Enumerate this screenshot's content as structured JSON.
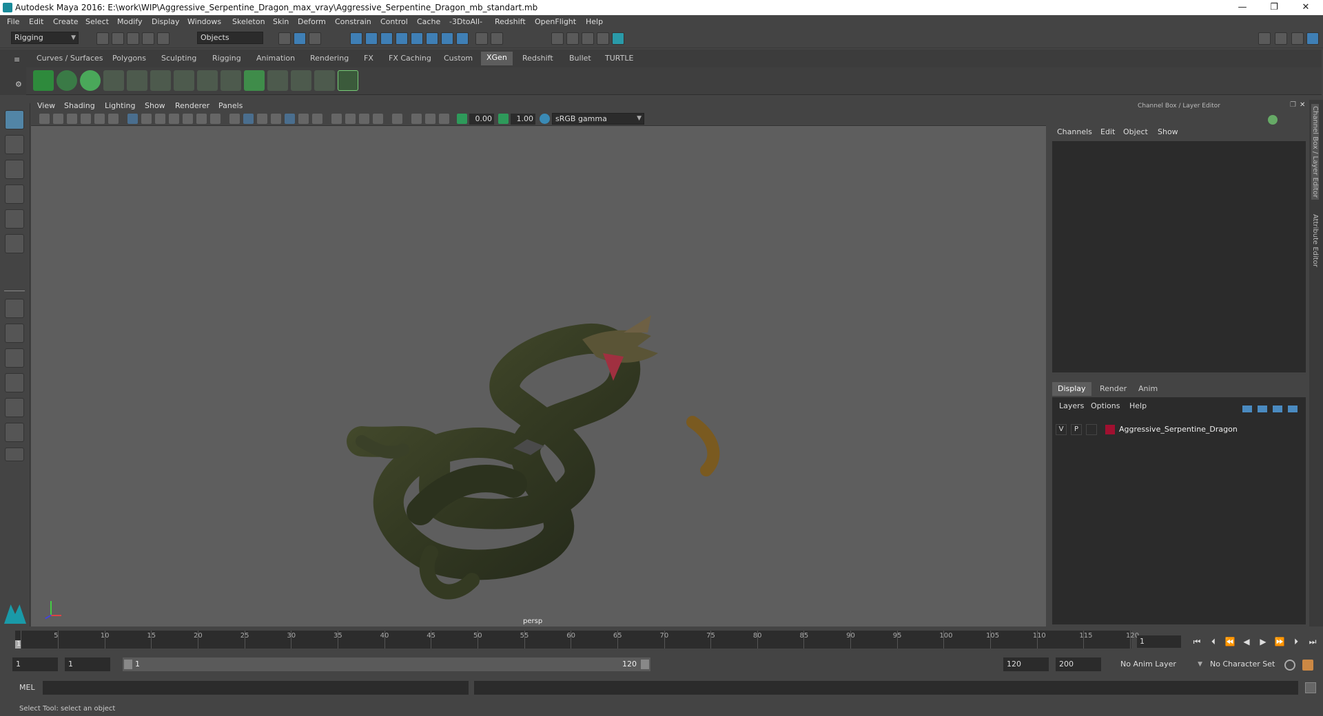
{
  "window": {
    "title": "Autodesk Maya 2016: E:\\work\\WIP\\Aggressive_Serpentine_Dragon_max_vray\\Aggressive_Serpentine_Dragon_mb_standart.mb",
    "minimize": "—",
    "maximize": "❐",
    "close": "✕"
  },
  "menubar": [
    "File",
    "Edit",
    "Create",
    "Select",
    "Modify",
    "Display",
    "Windows",
    "Skeleton",
    "Skin",
    "Deform",
    "Constrain",
    "Control",
    "Cache",
    "-3DtoAll-",
    "Redshift",
    "OpenFlight",
    "Help"
  ],
  "toolbar": {
    "mode": "Rigging",
    "selection_mode": "Objects"
  },
  "shelf": {
    "tabs": [
      "Curves / Surfaces",
      "Polygons",
      "Sculpting",
      "Rigging",
      "Animation",
      "Rendering",
      "FX",
      "FX Caching",
      "Custom",
      "XGen",
      "Redshift",
      "Bullet",
      "TURTLE"
    ],
    "active": "XGen"
  },
  "panel": {
    "menu": [
      "View",
      "Shading",
      "Lighting",
      "Show",
      "Renderer",
      "Panels"
    ],
    "exposure": "0.00",
    "gamma": "1.00",
    "colorspace": "sRGB gamma",
    "camera": "persp"
  },
  "channelbox": {
    "header": "Channel Box / Layer Editor",
    "menu": [
      "Channels",
      "Edit",
      "Object",
      "Show"
    ]
  },
  "layereditor": {
    "tabs": [
      "Display",
      "Render",
      "Anim"
    ],
    "active": "Display",
    "menu": [
      "Layers",
      "Options",
      "Help"
    ],
    "layer": {
      "v": "V",
      "p": "P",
      "name": "Aggressive_Serpentine_Dragon",
      "color": "#a01030"
    }
  },
  "sidetabs": [
    "Channel Box / Layer Editor",
    "Attribute Editor"
  ],
  "timeline": {
    "ticks": [
      "5",
      "10",
      "15",
      "20",
      "25",
      "30",
      "35",
      "40",
      "45",
      "50",
      "55",
      "60",
      "65",
      "70",
      "75",
      "80",
      "85",
      "90",
      "95",
      "100",
      "105",
      "110",
      "115",
      "120"
    ],
    "start_marker": "1",
    "current_frame": "1"
  },
  "range": {
    "start": "1",
    "playback_start": "1",
    "slider_start": "1",
    "slider_end": "120",
    "playback_end": "120",
    "end": "200",
    "anim_layer": "No Anim Layer",
    "character_set": "No Character Set"
  },
  "mel": {
    "label": "MEL"
  },
  "status": {
    "help": "Select Tool: select an object"
  }
}
